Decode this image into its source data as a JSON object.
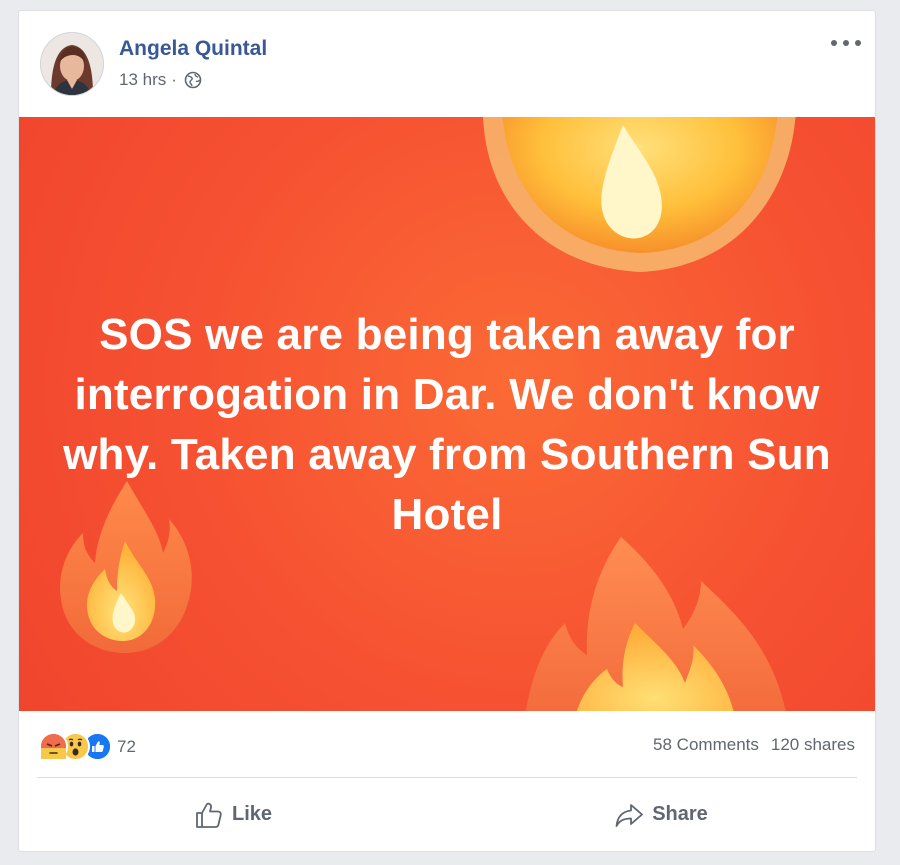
{
  "post": {
    "author": "Angela Quintal",
    "time": "13 hrs",
    "separator": "·",
    "privacy_icon": "globe-icon",
    "more_icon": "more-options-icon"
  },
  "banner": {
    "text": "SOS we are being taken away for interrogation in Dar. We don't know why. Taken away from Southern Sun Hotel",
    "background": "#f65132",
    "decoration_icon": "fire-emoji"
  },
  "stats": {
    "reactions": [
      "angry-reaction-icon",
      "wow-reaction-icon",
      "like-reaction-icon"
    ],
    "reaction_count": "72",
    "comments": "58 Comments",
    "shares": "120 shares"
  },
  "actions": {
    "like_label": "Like",
    "share_label": "Share"
  },
  "colors": {
    "author_blue": "#385898",
    "meta_gray": "#606770",
    "like_blue": "#1877f2",
    "angry_orange": "#e8684a",
    "wow_yellow": "#f7c84a"
  }
}
